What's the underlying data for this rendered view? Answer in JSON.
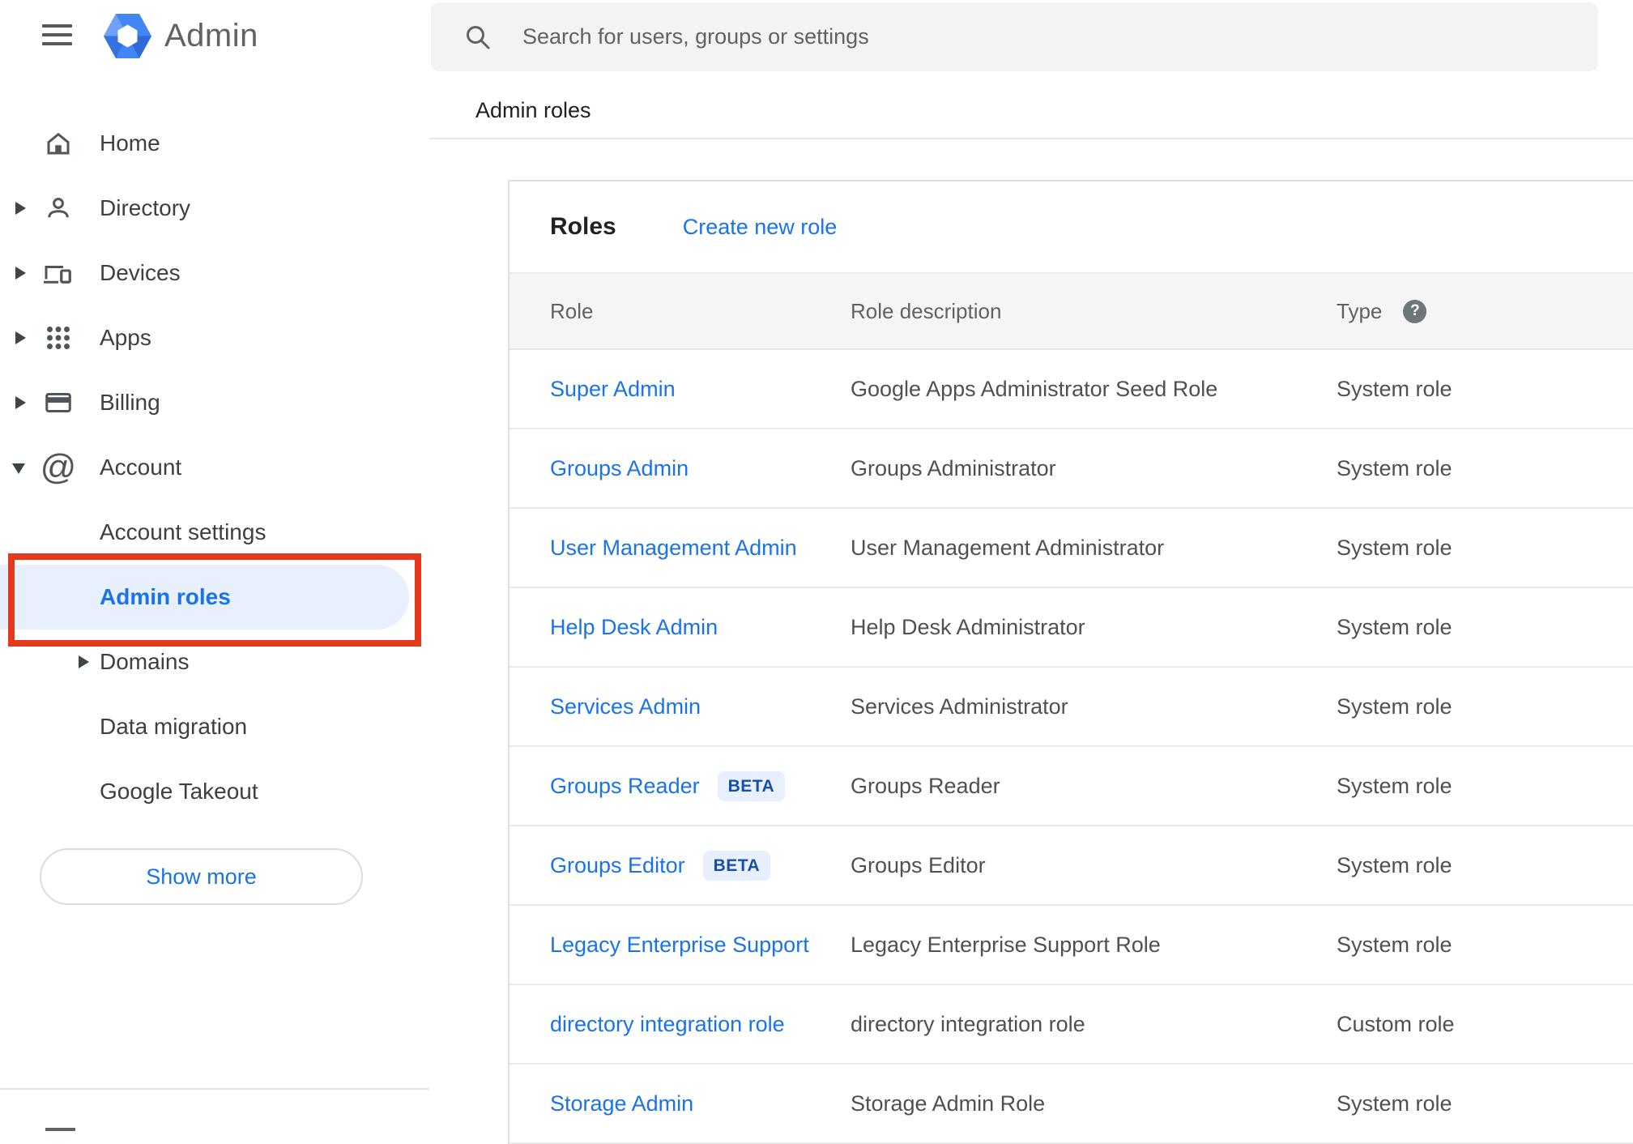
{
  "app": {
    "title": "Admin"
  },
  "search": {
    "placeholder": "Search for users, groups or settings"
  },
  "breadcrumb": "Admin roles",
  "sidebar": {
    "items": [
      {
        "label": "Home",
        "icon": "home",
        "arrow": "none",
        "level": "top"
      },
      {
        "label": "Directory",
        "icon": "person",
        "arrow": "collapsed",
        "level": "top"
      },
      {
        "label": "Devices",
        "icon": "devices",
        "arrow": "collapsed",
        "level": "top"
      },
      {
        "label": "Apps",
        "icon": "apps",
        "arrow": "collapsed",
        "level": "top"
      },
      {
        "label": "Billing",
        "icon": "card",
        "arrow": "collapsed",
        "level": "top"
      },
      {
        "label": "Account",
        "icon": "at",
        "arrow": "expanded",
        "level": "top"
      },
      {
        "label": "Account settings",
        "icon": "",
        "arrow": "none",
        "level": "sub"
      },
      {
        "label": "Admin roles",
        "icon": "",
        "arrow": "none",
        "level": "sub",
        "selected": true
      },
      {
        "label": "Domains",
        "icon": "",
        "arrow": "collapsed",
        "level": "sub"
      },
      {
        "label": "Data migration",
        "icon": "",
        "arrow": "none",
        "level": "sub"
      },
      {
        "label": "Google Takeout",
        "icon": "",
        "arrow": "none",
        "level": "sub"
      }
    ],
    "show_more_label": "Show more"
  },
  "roles_card": {
    "title": "Roles",
    "create_link": "Create new role",
    "columns": [
      "Role",
      "Role description",
      "Type"
    ],
    "type_help_glyph": "?",
    "beta_label": "BETA",
    "rows": [
      {
        "role": "Super Admin",
        "beta": false,
        "description": "Google Apps Administrator Seed Role",
        "type": "System role"
      },
      {
        "role": "Groups Admin",
        "beta": false,
        "description": "Groups Administrator",
        "type": "System role"
      },
      {
        "role": "User Management Admin",
        "beta": false,
        "description": "User Management Administrator",
        "type": "System role"
      },
      {
        "role": "Help Desk Admin",
        "beta": false,
        "description": "Help Desk Administrator",
        "type": "System role"
      },
      {
        "role": "Services Admin",
        "beta": false,
        "description": "Services Administrator",
        "type": "System role"
      },
      {
        "role": "Groups Reader",
        "beta": true,
        "description": "Groups Reader",
        "type": "System role"
      },
      {
        "role": "Groups Editor",
        "beta": true,
        "description": "Groups Editor",
        "type": "System role"
      },
      {
        "role": "Legacy Enterprise Support",
        "beta": false,
        "description": "Legacy Enterprise Support Role",
        "type": "System role"
      },
      {
        "role": "directory integration role",
        "beta": false,
        "description": "directory integration role",
        "type": "Custom role"
      },
      {
        "role": "Storage Admin",
        "beta": false,
        "description": "Storage Admin Role",
        "type": "System role"
      }
    ]
  },
  "colors": {
    "accent_blue": "#1a73e8",
    "annotation_red": "#e6391c",
    "selected_item_bg": "#e8f0fe",
    "beta_badge_bg": "#e8f0fe",
    "beta_badge_text": "#174ea6",
    "table_header_bg": "#f5f5f5",
    "search_bar_bg": "#f1f3f4",
    "divider": "#e4e4e4",
    "icon_gray": "#50555a",
    "text_dark": "#202124",
    "text_gray": "#5f6368",
    "logo_blue": "#4285f4"
  }
}
